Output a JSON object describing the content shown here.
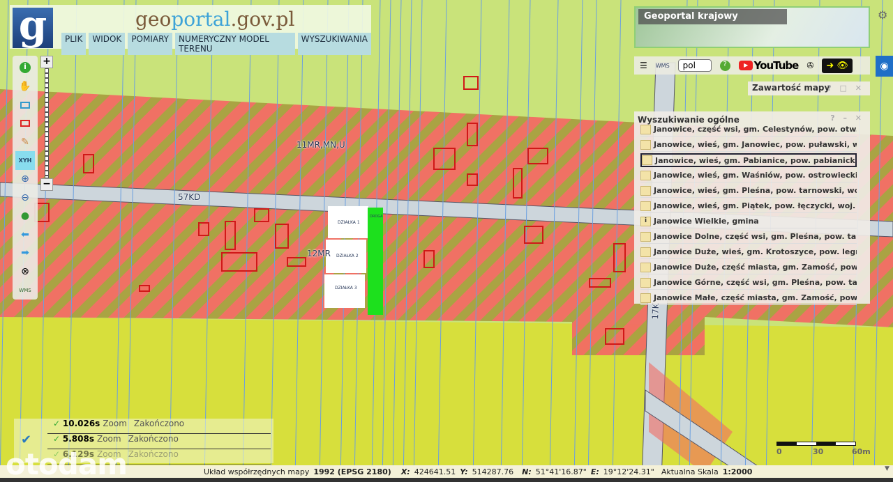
{
  "header": {
    "logo": "g",
    "brand_pre": "geo",
    "brand_mid": "portal",
    "brand_post": ".gov.pl",
    "menu": [
      "PLIK",
      "WIDOK",
      "POMIARY",
      "NUMERYCZNY MODEL TERENU",
      "WYSZUKIWANIA"
    ]
  },
  "map": {
    "labels": {
      "zone_north": "11MR,MN,U",
      "road": "57KD",
      "zone_south": "12MR",
      "road_east": "17K"
    },
    "plots": [
      "DZIAŁKA 1",
      "DZIAŁKA 2",
      "DZIAŁKA 3"
    ],
    "road_plot": "DROGA"
  },
  "minimap": {
    "title": "Geoportal krajowy"
  },
  "toolbar2": {
    "language": "pol",
    "youtube": "YouTube",
    "wms": "WMS"
  },
  "map_contents": {
    "title": "Zawartość mapy",
    "controls": "? □ ✕"
  },
  "search": {
    "title": "Wyszukiwanie ogólne",
    "controls": "? – ✕",
    "results": [
      "Janowice, część wsi, gm. Celestynów, pow. otw...",
      "Janowice, wieś, gm. Janowiec, pow. puławski, w...",
      "Janowice, wieś, gm. Pabianice, pow. pabianicki,...",
      "Janowice, wieś, gm. Waśniów, pow. ostrowiecki...",
      "Janowice, wieś, gm. Pleśna, pow. tarnowski, wo...",
      "Janowice, wieś, gm. Piątek, pow. łęczycki, woj. ł...",
      "Janowice Wielkie, gmina",
      "Janowice Dolne, część wsi, gm. Pleśna, pow. tar...",
      "Janowice Duże, wieś, gm. Krotoszyce, pow. legn...",
      "Janowice Duże, część miasta, gm. Zamość, pow....",
      "Janowice Górne, część wsi, gm. Pleśna, pow. tar...",
      "Janowice Małe, część miasta, gm. Zamość, pow. ..."
    ],
    "selected_index": 2
  },
  "log": [
    {
      "time": "10.026s",
      "action": "Zoom",
      "status": "Zakończono"
    },
    {
      "time": "5.808s",
      "action": "Zoom",
      "status": "Zakończono"
    },
    {
      "time": "6.129s",
      "action": "Zoom",
      "status": "Zakończono"
    }
  ],
  "status": {
    "crs_label": "Układ współrzędnych mapy",
    "crs": "1992 (EPSG 2180)",
    "x_label": "X:",
    "x": "424641.51",
    "y_label": "Y:",
    "y": "514287.76",
    "n_label": "N:",
    "n": "51°41'16.87\"",
    "e_label": "E:",
    "e": "19°12'24.31\"",
    "scale_label": "Aktualna Skala",
    "scale": "1:2000"
  },
  "scalebar": {
    "ticks": [
      "0",
      "30",
      "60m"
    ]
  },
  "watermark": "otodam",
  "colors": {
    "zone": "#f26b63",
    "stripe": "#a8a040",
    "field": "#d8e03a",
    "meadow": "#c9e37a"
  }
}
